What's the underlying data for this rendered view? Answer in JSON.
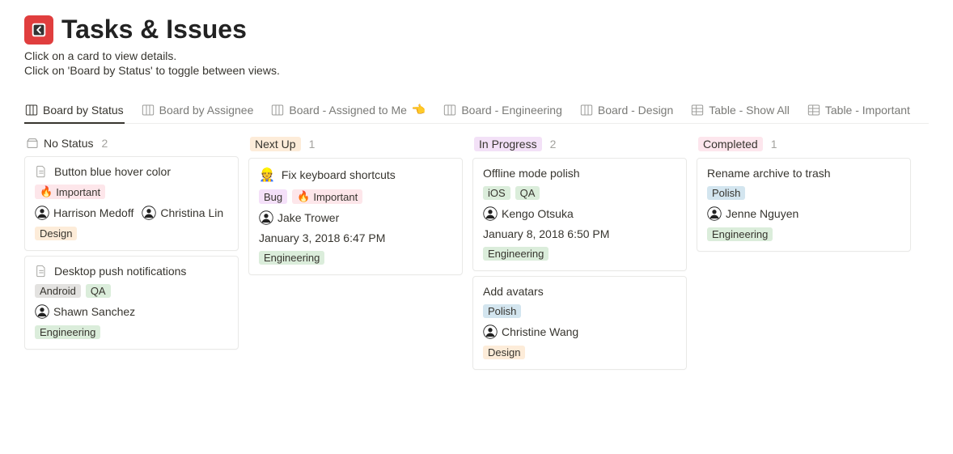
{
  "header": {
    "title": "Tasks & Issues",
    "subtitle_1": "Click on a card to view details.",
    "subtitle_2": "Click on 'Board by Status' to toggle between views."
  },
  "views": [
    {
      "label": "Board by Status",
      "icon": "board",
      "active": true
    },
    {
      "label": "Board by Assignee",
      "icon": "board",
      "active": false
    },
    {
      "label": "Board - Assigned to Me",
      "icon": "board",
      "emoji": "👈",
      "active": false
    },
    {
      "label": "Board - Engineering",
      "icon": "board",
      "active": false
    },
    {
      "label": "Board - Design",
      "icon": "board",
      "active": false
    },
    {
      "label": "Table - Show All",
      "icon": "table",
      "active": false
    },
    {
      "label": "Table - Important",
      "icon": "table",
      "active": false
    }
  ],
  "columns": [
    {
      "name": "No Status",
      "style": "nostatus",
      "count": "2",
      "cards": [
        {
          "title": "Button blue hover color",
          "title_icon": "page",
          "priority": [
            {
              "label": "Important",
              "class": "tag-important",
              "emoji": "🔥"
            }
          ],
          "people": [
            {
              "name": "Harrison Medoff"
            },
            {
              "name": "Christina Lin"
            }
          ],
          "team": [
            {
              "label": "Design",
              "class": "tag-design"
            }
          ]
        },
        {
          "title": "Desktop push notifications",
          "title_icon": "page",
          "project": [
            {
              "label": "Android",
              "class": "tag-android"
            },
            {
              "label": "QA",
              "class": "tag-qa"
            }
          ],
          "people": [
            {
              "name": "Shawn Sanchez"
            }
          ],
          "team": [
            {
              "label": "Engineering",
              "class": "tag-engineering"
            }
          ]
        }
      ]
    },
    {
      "name": "Next Up",
      "style": "nextup",
      "count": "1",
      "cards": [
        {
          "title": "Fix keyboard shortcuts",
          "title_icon": "emoji",
          "title_emoji": "👷",
          "priority": [
            {
              "label": "Bug",
              "class": "tag-bug"
            },
            {
              "label": "Important",
              "class": "tag-important",
              "emoji": "🔥"
            }
          ],
          "people": [
            {
              "name": "Jake Trower"
            }
          ],
          "date": "January 3, 2018 6:47 PM",
          "team": [
            {
              "label": "Engineering",
              "class": "tag-engineering"
            }
          ]
        }
      ]
    },
    {
      "name": "In Progress",
      "style": "inprogress",
      "count": "2",
      "cards": [
        {
          "title": "Offline mode polish",
          "project": [
            {
              "label": "iOS",
              "class": "tag-ios"
            },
            {
              "label": "QA",
              "class": "tag-qa"
            }
          ],
          "people": [
            {
              "name": "Kengo Otsuka"
            }
          ],
          "date": "January 8, 2018 6:50 PM",
          "team": [
            {
              "label": "Engineering",
              "class": "tag-engineering"
            }
          ]
        },
        {
          "title": "Add avatars",
          "project": [
            {
              "label": "Polish",
              "class": "tag-polish"
            }
          ],
          "people": [
            {
              "name": "Christine Wang"
            }
          ],
          "team": [
            {
              "label": "Design",
              "class": "tag-design"
            }
          ]
        }
      ]
    },
    {
      "name": "Completed",
      "style": "completed",
      "count": "1",
      "cards": [
        {
          "title": "Rename archive to trash",
          "project": [
            {
              "label": "Polish",
              "class": "tag-polish"
            }
          ],
          "people": [
            {
              "name": "Jenne Nguyen"
            }
          ],
          "team": [
            {
              "label": "Engineering",
              "class": "tag-engineering"
            }
          ]
        }
      ]
    }
  ]
}
